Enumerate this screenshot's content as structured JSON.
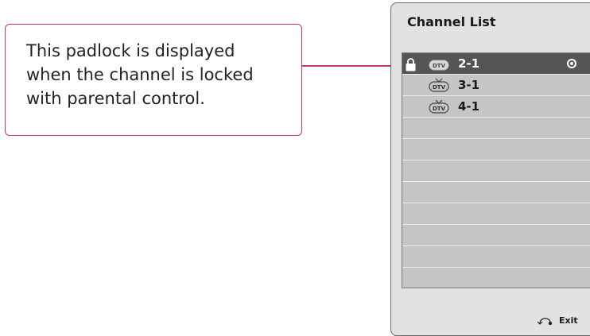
{
  "callout": {
    "text": "This padlock is displayed when the channel is locked with parental control."
  },
  "panel": {
    "title": "Channel List",
    "channels": [
      {
        "number": "2-1",
        "badge": "DTV",
        "locked": true,
        "selected": true
      },
      {
        "number": "3-1",
        "badge": "DTV",
        "locked": false,
        "selected": false
      },
      {
        "number": "4-1",
        "badge": "DTV",
        "locked": false,
        "selected": false
      }
    ],
    "empty_rows": 8,
    "exit_label": "Exit"
  },
  "colors": {
    "callout_border": "#c23a5e",
    "leader_dot": "#d2165e",
    "selected_row": "#555555",
    "list_bg": "#c5c5c5",
    "panel_bg": "#e2e2e2"
  },
  "icons": {
    "lock": "padlock-icon",
    "channel_badge": "dtv-tv-icon",
    "selected_marker": "radio-selected-icon",
    "exit": "back-arrow-icon"
  }
}
